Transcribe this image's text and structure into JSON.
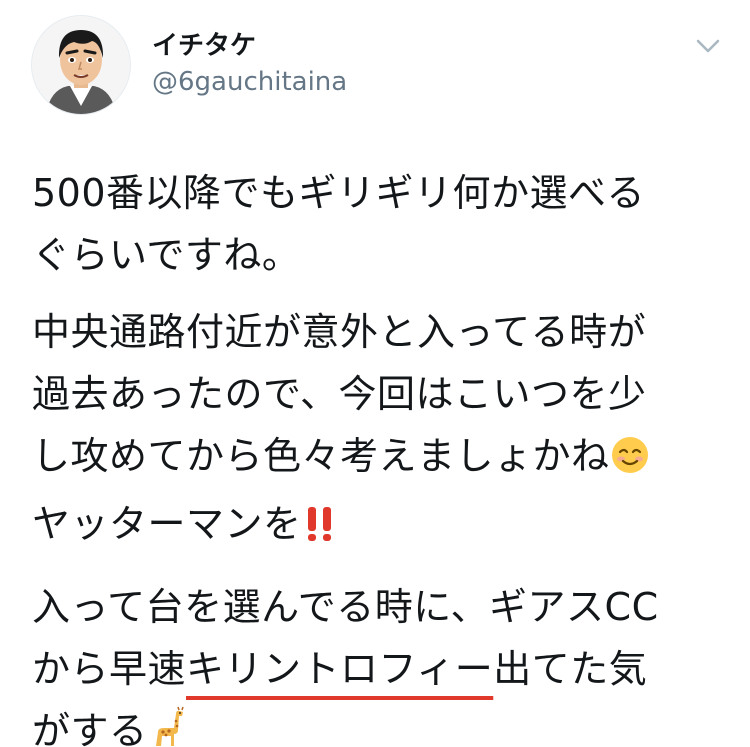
{
  "user": {
    "display_name": "イチタケ",
    "handle": "@6gauchitaina"
  },
  "tweet": {
    "p1": {
      "l1": "500番以降でもギリギリ何か選べる",
      "l2": "ぐらいですね。"
    },
    "p2": {
      "l1": "中央通路付近が意外と入ってる時が",
      "l2": "過去あったので、今回はこいつを少",
      "l3": "し攻めてから色々考えましょかね",
      "l4": "ヤッターマンを"
    },
    "p3": {
      "l1": "入って台を選んでる時に、ギアスCC",
      "l2_pre": "から早速",
      "l2_hl": "キリントロフィー",
      "l2_post": "出てた気",
      "l3": "がする"
    }
  },
  "icons": {
    "caret": "chevron-down-icon",
    "emoji_1": "relieved-smile-emoji",
    "emoji_2": "double-exclamation-emoji",
    "emoji_3": "giraffe-emoji"
  },
  "colors": {
    "text": "#14171a",
    "secondary": "#657786",
    "underline": "#e0392b",
    "exclamation": "#e0392b"
  }
}
